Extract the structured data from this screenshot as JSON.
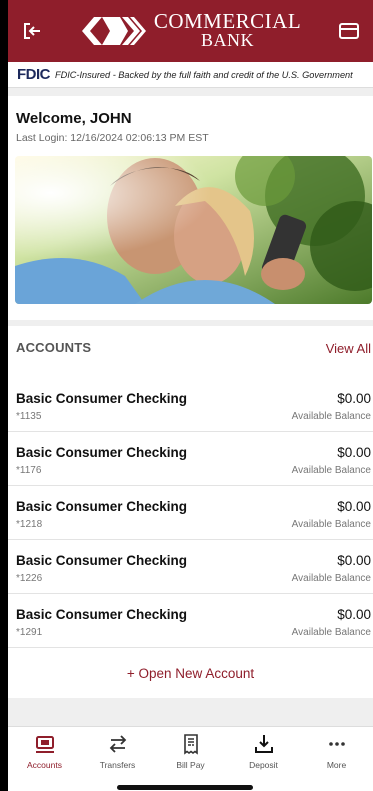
{
  "header": {
    "brand_line1": "COMMERCIAL",
    "brand_line2": "BANK",
    "left_icon": "logout-icon",
    "right_icon": "card-icon"
  },
  "fdic": {
    "logo": "FDIC",
    "text": "FDIC-Insured - Backed by the full faith and credit of the U.S. Government"
  },
  "welcome": {
    "title": "Welcome, JOHN",
    "last_login": "Last Login: 12/16/2024 02:06:13 PM EST"
  },
  "accounts": {
    "heading": "ACCOUNTS",
    "view_all": "View All",
    "items": [
      {
        "name": "Basic Consumer Checking",
        "number": "*1135",
        "balance": "$0.00",
        "balance_label": "Available Balance"
      },
      {
        "name": "Basic Consumer Checking",
        "number": "*1176",
        "balance": "$0.00",
        "balance_label": "Available Balance"
      },
      {
        "name": "Basic Consumer Checking",
        "number": "*1218",
        "balance": "$0.00",
        "balance_label": "Available Balance"
      },
      {
        "name": "Basic Consumer Checking",
        "number": "*1226",
        "balance": "$0.00",
        "balance_label": "Available Balance"
      },
      {
        "name": "Basic Consumer Checking",
        "number": "*1291",
        "balance": "$0.00",
        "balance_label": "Available Balance"
      }
    ],
    "open_new": "+ Open New Account"
  },
  "nav": {
    "items": [
      {
        "label": "Accounts",
        "icon": "accounts-icon",
        "active": true
      },
      {
        "label": "Transfers",
        "icon": "transfer-arrows-icon",
        "active": false
      },
      {
        "label": "Bill Pay",
        "icon": "bill-icon",
        "active": false
      },
      {
        "label": "Deposit",
        "icon": "download-tray-icon",
        "active": false
      },
      {
        "label": "More",
        "icon": "more-dots-icon",
        "active": false
      }
    ]
  },
  "colors": {
    "brand": "#8f1e2b",
    "background": "#efefef"
  }
}
